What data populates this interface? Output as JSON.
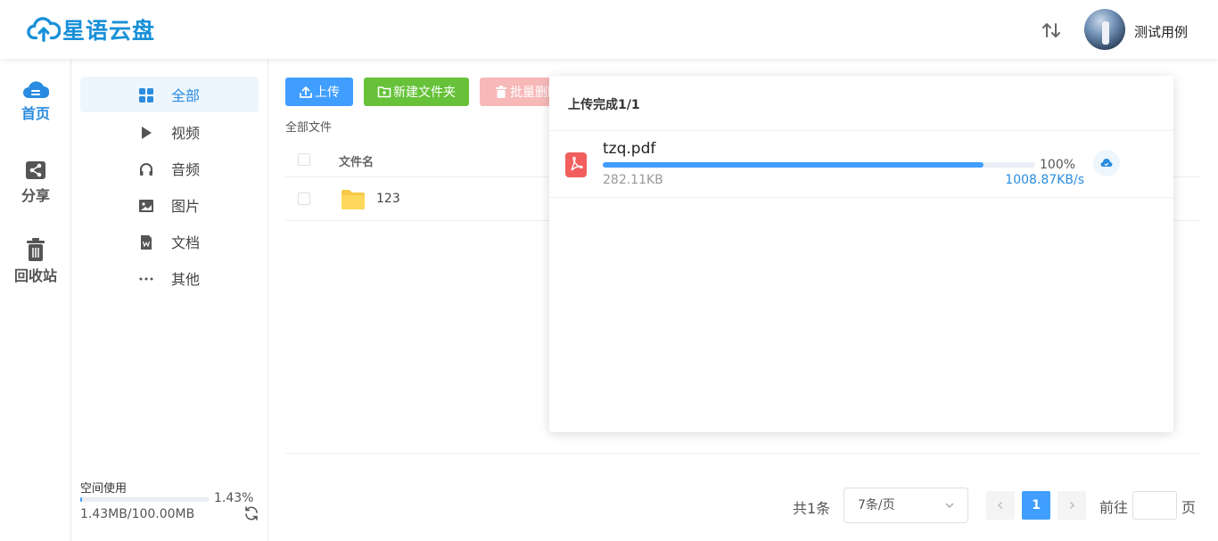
{
  "header": {
    "app_name": "星语云盘",
    "user_name": "测试用例",
    "brand_color": "#1890d8"
  },
  "left_nav": {
    "items": [
      {
        "label": "首页",
        "icon": "cloud-icon",
        "active": true
      },
      {
        "label": "分享",
        "icon": "share-icon",
        "active": false
      },
      {
        "label": "回收站",
        "icon": "trash-icon",
        "active": false
      }
    ]
  },
  "sidebar": {
    "items": [
      {
        "label": "全部",
        "icon": "grid-icon",
        "active": true
      },
      {
        "label": "视频",
        "icon": "play-icon",
        "active": false
      },
      {
        "label": "音频",
        "icon": "headphones-icon",
        "active": false
      },
      {
        "label": "图片",
        "icon": "image-icon",
        "active": false
      },
      {
        "label": "文档",
        "icon": "document-icon",
        "active": false
      },
      {
        "label": "其他",
        "icon": "more-icon",
        "active": false
      }
    ],
    "space": {
      "label": "空间使用",
      "percent_text": "1.43%",
      "percent": 1.43,
      "size_text": "1.43MB/100.00MB"
    }
  },
  "toolbar": {
    "upload_label": "上传",
    "new_folder_label": "新建文件夹",
    "batch_delete_label": "批量删除"
  },
  "breadcrumb": "全部文件",
  "table": {
    "column_name": "文件名",
    "rows": [
      {
        "name": "123",
        "type": "folder"
      }
    ]
  },
  "pagination": {
    "total_text": "共1条",
    "page_size": "7条/页",
    "current_page": "1",
    "goto_label": "前往",
    "goto_unit": "页"
  },
  "upload_panel": {
    "title": "上传完成1/1",
    "file": {
      "name": "tzq.pdf",
      "percent_text": "100%",
      "percent": 100,
      "size": "282.11KB",
      "speed": "1008.87KB/s"
    }
  }
}
